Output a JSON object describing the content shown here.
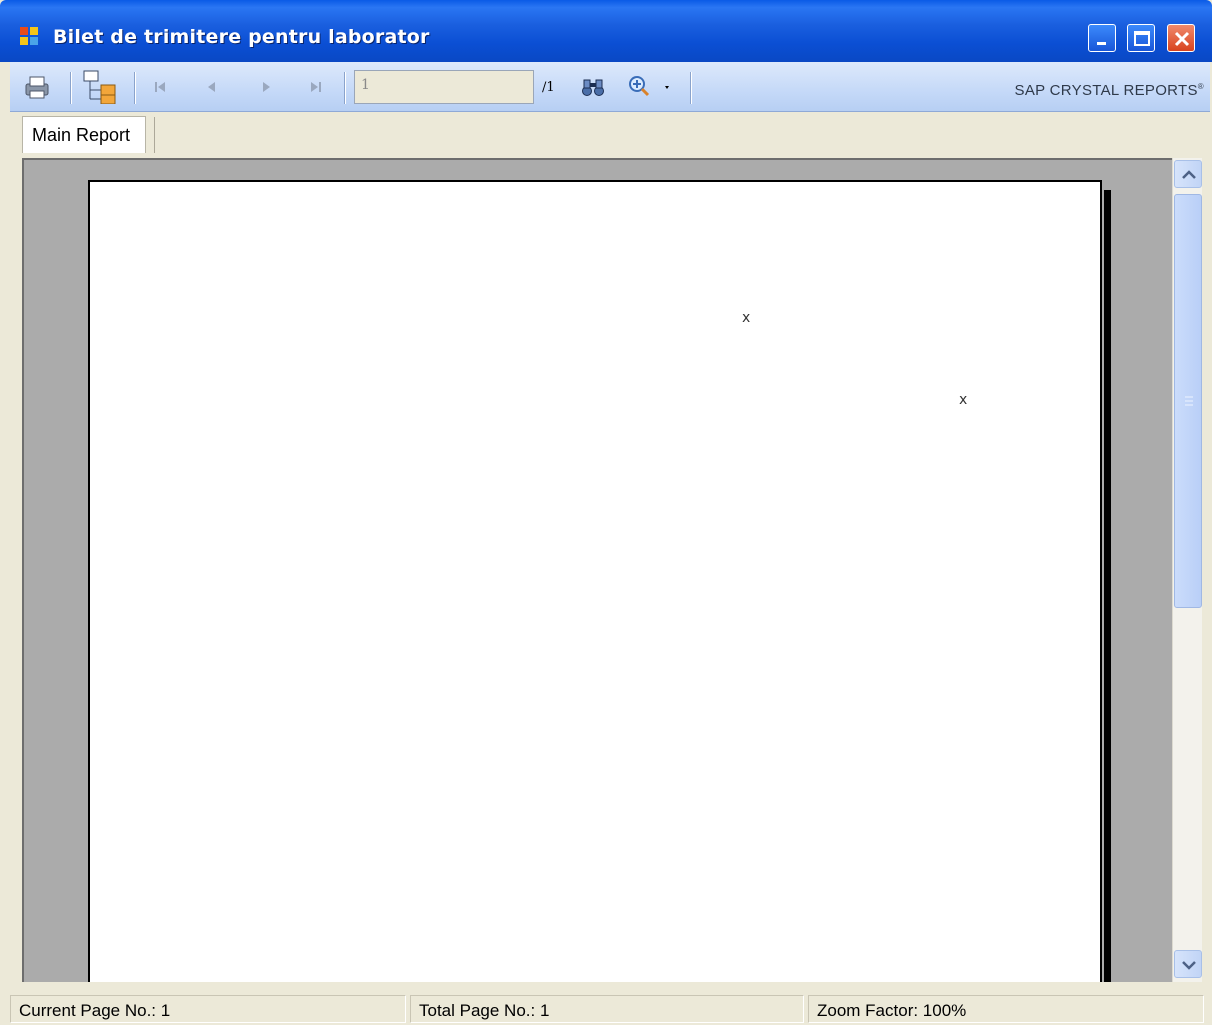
{
  "window": {
    "title": "Bilet de trimitere pentru laborator"
  },
  "toolbar": {
    "page_input_value": "1",
    "page_total": "/1",
    "brand": "SAP CRYSTAL REPORTS",
    "brand_mark": "®"
  },
  "tabs": [
    {
      "label": "Main Report"
    }
  ],
  "report": {
    "marks": [
      "x",
      "x"
    ]
  },
  "status": {
    "current_page": "Current Page No.: 1",
    "total_pages": "Total Page No.: 1",
    "zoom": "Zoom Factor: 100%"
  },
  "colors": {
    "title_bar": "#0b4fd4",
    "toolbar": "#c5d9f8",
    "viewer_bg": "#ababab",
    "face": "#ece9d8"
  }
}
